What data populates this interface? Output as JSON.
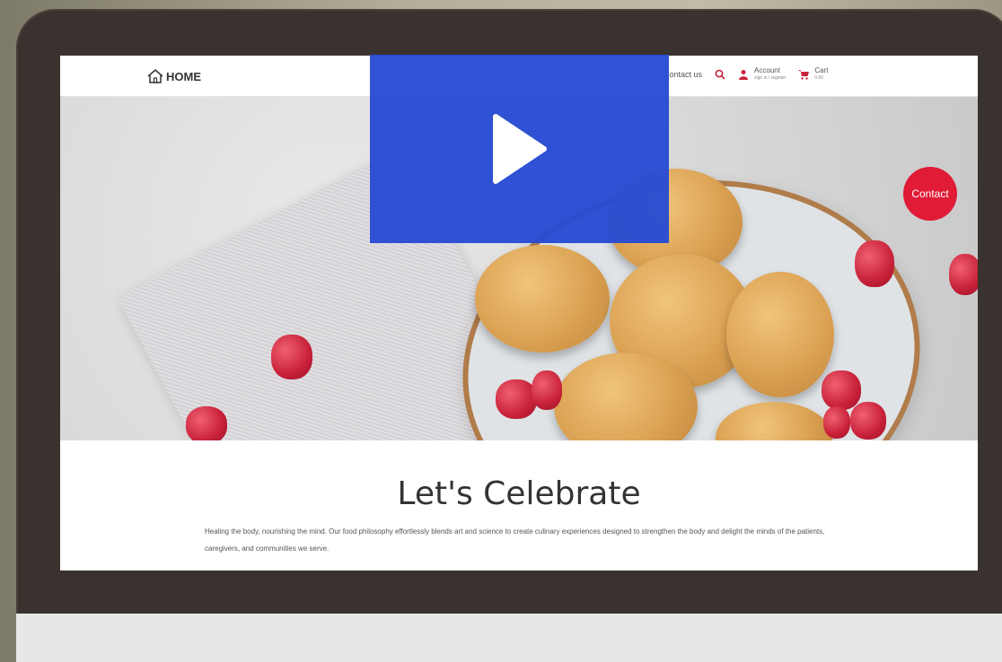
{
  "header": {
    "logo_label": "HOME",
    "nav_contact": "Contact us",
    "account_label": "Account",
    "account_sub": "sign in / register",
    "cart_label": "Cart",
    "cart_sub": "0.00"
  },
  "hero": {
    "contact_badge": "Contact"
  },
  "content": {
    "headline": "Let's Celebrate",
    "blurb": "Healing the body, nourishing the mind. Our food philosophy effortlessly blends art and science to create culinary experiences designed to strengthen the body and delight the minds of the patients, caregivers, and communities we serve."
  },
  "colors": {
    "accent_red": "#e01b36",
    "video_blue": "#2b4bd2",
    "laptop_frame": "#3a322e"
  },
  "icons": [
    "home-icon",
    "search-icon",
    "user-icon",
    "cart-icon",
    "play-icon"
  ]
}
